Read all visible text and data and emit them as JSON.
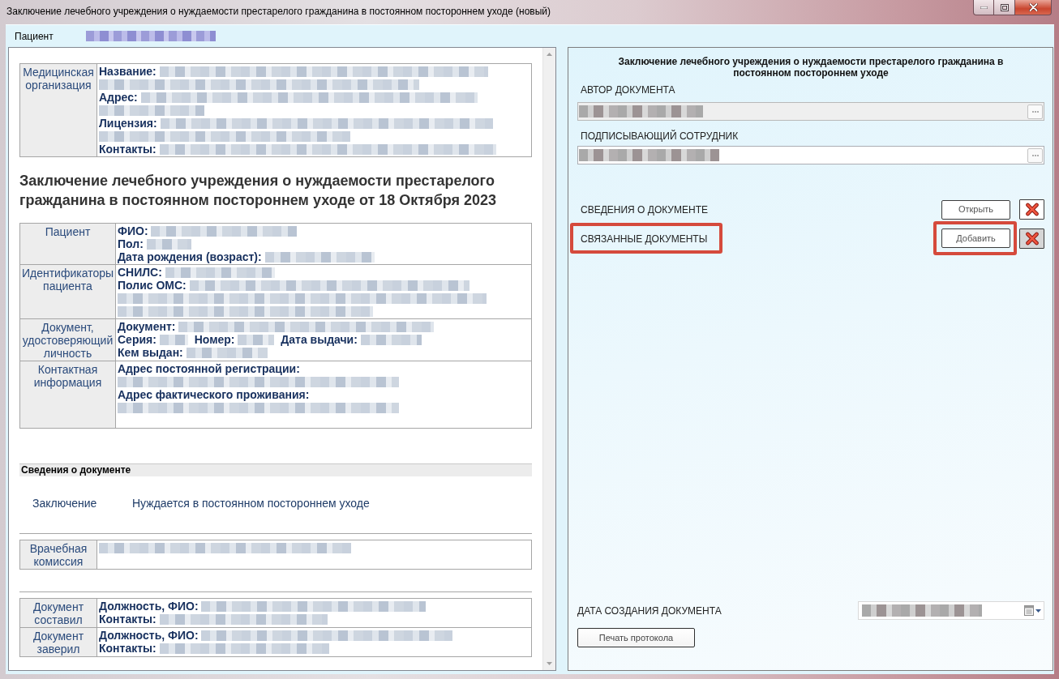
{
  "window": {
    "title": "Заключение лечебного учреждения о нуждаемости престарелого гражданина в постоянном постороннем уходе (новый)",
    "controls": [
      {
        "kind": "minimize"
      },
      {
        "kind": "maximize"
      },
      {
        "kind": "close"
      }
    ]
  },
  "patient_bar": {
    "label": "Пациент",
    "redacted": true
  },
  "document": {
    "organization": {
      "header": "Медицинская организация",
      "lines": [
        [
          {
            "label": "Название:",
            "redacted": true
          }
        ],
        [
          {
            "label": "Адрес:",
            "redacted": true
          }
        ],
        [
          {
            "label": "Лицензия:",
            "redacted": true
          }
        ],
        [
          {
            "label": "Контакты:",
            "redacted": true
          }
        ]
      ]
    },
    "heading": "Заключение лечебного учреждения о нуждаемости престарелого гражданина в постоянном постороннем уходе от 18 Октября 2023",
    "patient_rows": [
      {
        "header": "Пациент",
        "lines": [
          [
            {
              "label": "ФИО:",
              "redacted": true
            }
          ],
          [
            {
              "label": "Пол:",
              "redacted": true
            }
          ],
          [
            {
              "label": "Дата рождения (возраст):",
              "redacted": true
            }
          ]
        ]
      },
      {
        "header": "Идентификаторы пациента",
        "lines": [
          [
            {
              "label": "СНИЛС:",
              "redacted": true
            }
          ],
          [
            {
              "label": "Полис ОМС:",
              "redacted": true
            }
          ]
        ]
      },
      {
        "header": "Документ, удостоверяющий личность",
        "lines": [
          [
            {
              "label": "Документ:",
              "redacted": true
            }
          ],
          [
            {
              "label": "Серия:",
              "redacted": true
            },
            {
              "label": "Номер:",
              "redacted": true
            },
            {
              "label": "Дата выдачи:",
              "redacted": true
            }
          ],
          [
            {
              "label": "Кем выдан:",
              "redacted": true
            }
          ]
        ]
      },
      {
        "header": "Контактная информация",
        "lines": [
          [
            {
              "label": "Адрес постоянной регистрации:",
              "redacted": true
            }
          ],
          [
            {
              "label": "Адрес фактического проживания:",
              "redacted": true
            }
          ]
        ]
      }
    ],
    "section": {
      "title": "Сведения о документе",
      "label": "Заключение",
      "value": "Нуждается в постоянном постороннем уходе"
    },
    "commission": {
      "header": "Врачебная комиссия",
      "lines": [
        [
          {
            "redacted": true
          }
        ]
      ]
    },
    "signers": [
      {
        "header": "Документ составил",
        "lines": [
          [
            {
              "label": "Должность, ФИО:",
              "redacted": true
            }
          ],
          [
            {
              "label": "Контакты:",
              "redacted": true
            }
          ]
        ]
      },
      {
        "header": "Документ заверил",
        "lines": [
          [
            {
              "label": "Должность, ФИО:",
              "redacted": true
            }
          ],
          [
            {
              "label": "Контакты:",
              "redacted": true
            }
          ]
        ]
      }
    ]
  },
  "side_panel": {
    "title": "Заключение лечебного учреждения о нуждаемости престарелого гражданина в постоянном постороннем уходе",
    "fields": [
      {
        "label": "АВТОР ДОКУМЕНТА",
        "disabled": true,
        "redacted": true
      },
      {
        "label": "ПОДПИСЫВАЮЩИЙ СОТРУДНИК",
        "disabled": false,
        "redacted": true
      }
    ],
    "sections": [
      {
        "label": "СВЕДЕНИЯ О ДОКУМЕНТЕ",
        "button": "Открыть",
        "highlighted": false,
        "delete_hovered": false
      },
      {
        "label": "СВЯЗАННЫЕ ДОКУМЕНТЫ",
        "button": "Добавить",
        "highlighted": true,
        "delete_hovered": true
      }
    ],
    "date": {
      "label": "ДАТА СОЗДАНИЯ ДОКУМЕНТА",
      "redacted": true
    },
    "print_button": "Печать протокола"
  }
}
